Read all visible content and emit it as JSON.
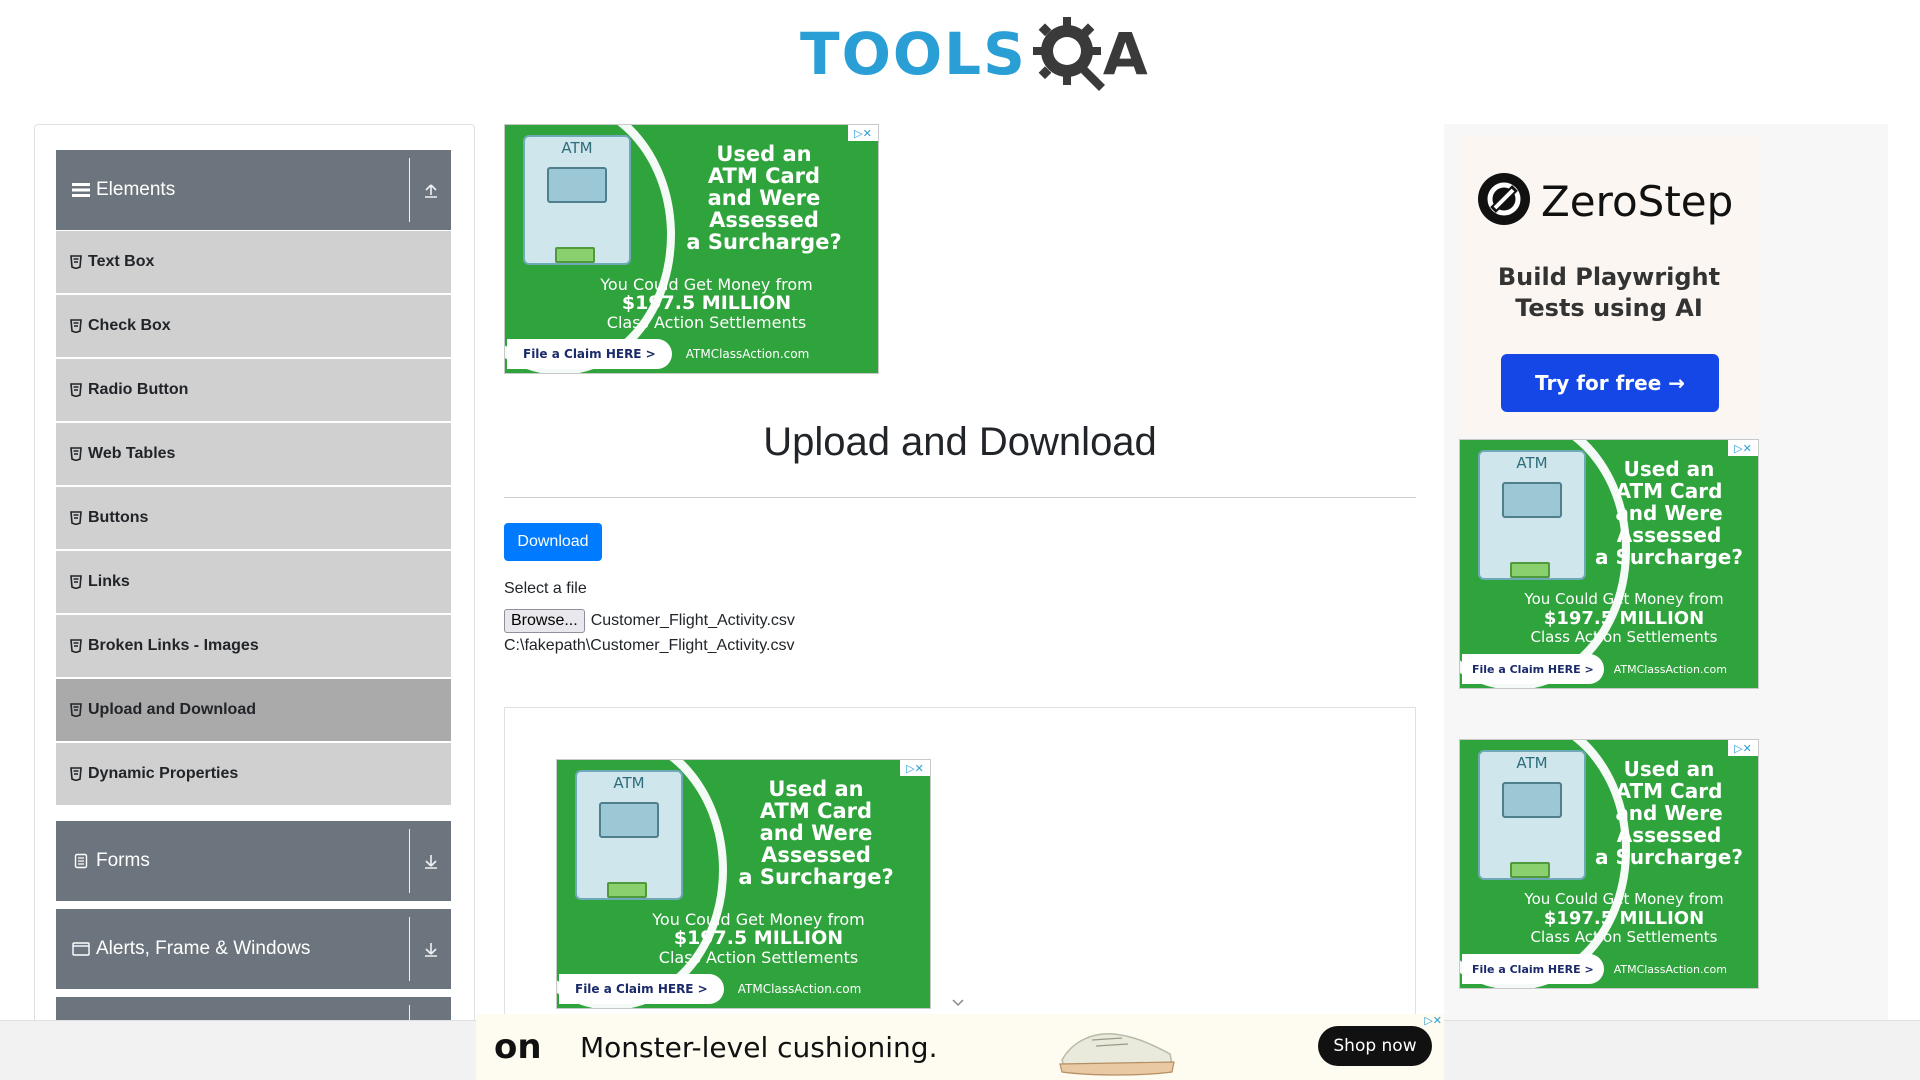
{
  "header": {
    "logo_text_tools": "TOOLS",
    "logo_text_a": "A"
  },
  "sidebar": {
    "groups": [
      {
        "label": "Elements",
        "icon": "hamburger-icon",
        "toggle_icon": "collapse-up-icon"
      },
      {
        "label": "Forms",
        "icon": "document-icon",
        "toggle_icon": "expand-down-icon"
      },
      {
        "label": "Alerts, Frame & Windows",
        "icon": "window-icon",
        "toggle_icon": "expand-down-icon"
      }
    ],
    "items": [
      {
        "label": "Text Box"
      },
      {
        "label": "Check Box"
      },
      {
        "label": "Radio Button"
      },
      {
        "label": "Web Tables"
      },
      {
        "label": "Buttons"
      },
      {
        "label": "Links"
      },
      {
        "label": "Broken Links - Images"
      },
      {
        "label": "Upload and Download",
        "active": true
      },
      {
        "label": "Dynamic Properties"
      }
    ]
  },
  "main": {
    "title": "Upload and Download",
    "download_button": "Download",
    "select_label": "Select a file",
    "browse_button": "Browse...",
    "file_name": "Customer_Flight_Activity.csv",
    "file_path": "C:\\fakepath\\Customer_Flight_Activity.csv"
  },
  "ads": {
    "atm": {
      "machine_label": "ATM",
      "headline_lines": [
        "Used an",
        "ATM Card",
        "and Were",
        "Assessed",
        "a Surcharge?"
      ],
      "sub_line1": "You Could Get Money from",
      "sub_line2": "$197.5 MILLION",
      "sub_line3": "Class Action Settlements",
      "cta": "File a Claim HERE >",
      "site": "ATMClassAction.com"
    },
    "zerostep": {
      "name": "ZeroStep",
      "tag_line1": "Build Playwright",
      "tag_line2": "Tests using AI",
      "button": "Try for free →"
    },
    "bottom": {
      "brand": "on",
      "text": "Monster-level cushioning.",
      "button": "Shop now"
    }
  },
  "colors": {
    "primary": "#007bff",
    "sidebar_header": "#6c757d",
    "sidebar_item": "#d0d0d0",
    "sidebar_item_active": "#aaaaaa",
    "ad_green": "#2fa33c",
    "logo_blue": "#2a9fd6"
  }
}
